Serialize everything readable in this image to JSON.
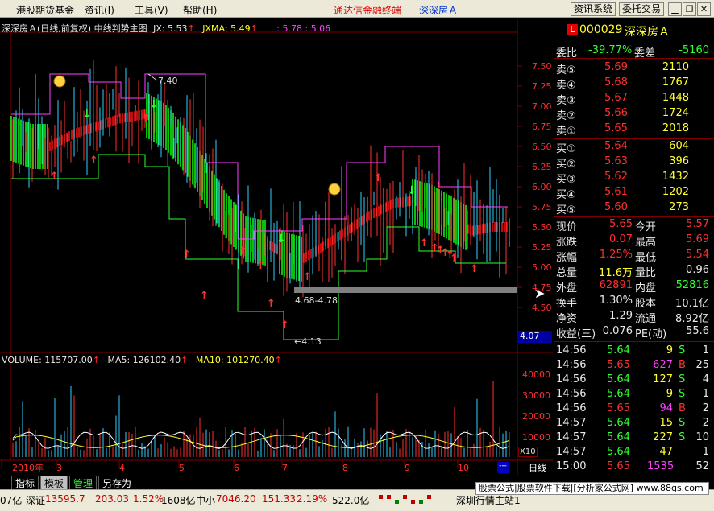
{
  "menu": {
    "item1": "港股期货基金",
    "item2": "资讯(I)",
    "item3": "工具(V)",
    "item4": "帮助(H)",
    "title": "通达信金融终端",
    "stock": "深深房Ａ",
    "btn_news": "资讯系统",
    "btn_order": "委托交易"
  },
  "chart": {
    "header": {
      "name": "深深房Ａ(日线,前复权) 中线判势主图",
      "jx": "JX: 5.53",
      "jxma": "JXMA: 5.49",
      "extra": ": 5.78 : 5.06"
    },
    "price_axis": [
      "7.50",
      "7.25",
      "7.00",
      "6.75",
      "6.50",
      "6.25",
      "6.00",
      "5.75",
      "5.50",
      "5.25",
      "5.00",
      "4.75",
      "4.50"
    ],
    "price_current": "4.07",
    "annotations": {
      "high": "7.40",
      "low": "4.13",
      "range": "4.68-4.78"
    },
    "volume_header": {
      "vol": "VOLUME: 115707.00",
      "ma5": "MA5: 126102.40",
      "ma10": "MA10: 101270.40"
    },
    "volume_axis": [
      "40000",
      "30000",
      "20000",
      "10000"
    ],
    "volume_unit": "X10",
    "dates": [
      "2010年",
      "3",
      "4",
      "5",
      "6",
      "7",
      "8",
      "9",
      "10"
    ],
    "period": "日线",
    "bottom_tabs": [
      "指标",
      "模板",
      "管理",
      "另存为"
    ]
  },
  "quote": {
    "code": "000029",
    "name": "深深房Ａ",
    "weibi_label": "委比",
    "weibi": "-39.77%",
    "weicha_label": "委差",
    "weicha": "-5160",
    "asks": [
      {
        "l": "卖⑤",
        "p": "5.69",
        "v": "2110"
      },
      {
        "l": "卖④",
        "p": "5.68",
        "v": "1767"
      },
      {
        "l": "卖③",
        "p": "5.67",
        "v": "1448"
      },
      {
        "l": "卖②",
        "p": "5.66",
        "v": "1724"
      },
      {
        "l": "卖①",
        "p": "5.65",
        "v": "2018"
      }
    ],
    "bids": [
      {
        "l": "买①",
        "p": "5.64",
        "v": "604"
      },
      {
        "l": "买②",
        "p": "5.63",
        "v": "396"
      },
      {
        "l": "买③",
        "p": "5.62",
        "v": "1432"
      },
      {
        "l": "买④",
        "p": "5.61",
        "v": "1202"
      },
      {
        "l": "买⑤",
        "p": "5.60",
        "v": "273"
      }
    ],
    "stats": [
      {
        "l1": "现价",
        "v1": "5.65",
        "l2": "今开",
        "v2": "5.57"
      },
      {
        "l1": "涨跌",
        "v1": "0.07",
        "l2": "最高",
        "v2": "5.69"
      },
      {
        "l1": "涨幅",
        "v1": "1.25%",
        "l2": "最低",
        "v2": "5.54"
      },
      {
        "l1": "总量",
        "v1": "11.6万",
        "l2": "量比",
        "v2": "0.96"
      },
      {
        "l1": "外盘",
        "v1": "62891",
        "l2": "内盘",
        "v2": "52816"
      },
      {
        "l1": "换手",
        "v1": "1.30%",
        "l2": "股本",
        "v2": "10.1亿"
      },
      {
        "l1": "净资",
        "v1": "1.29",
        "l2": "流通",
        "v2": "8.92亿"
      },
      {
        "l1": "收益(三)",
        "v1": "0.076",
        "l2": "PE(动)",
        "v2": "55.6"
      }
    ],
    "ticks": [
      {
        "t": "14:56",
        "p": "5.64",
        "v": "9",
        "s": "S",
        "n": "1"
      },
      {
        "t": "14:56",
        "p": "5.65",
        "v": "627",
        "s": "B",
        "n": "25"
      },
      {
        "t": "14:56",
        "p": "5.64",
        "v": "127",
        "s": "S",
        "n": "4"
      },
      {
        "t": "14:56",
        "p": "5.64",
        "v": "9",
        "s": "S",
        "n": "1"
      },
      {
        "t": "14:56",
        "p": "5.65",
        "v": "94",
        "s": "B",
        "n": "2"
      },
      {
        "t": "14:57",
        "p": "5.64",
        "v": "15",
        "s": "S",
        "n": "2"
      },
      {
        "t": "14:57",
        "p": "5.64",
        "v": "227",
        "s": "S",
        "n": "10"
      },
      {
        "t": "14:57",
        "p": "5.64",
        "v": "47",
        "s": "",
        "n": "1"
      },
      {
        "t": "15:00",
        "p": "5.65",
        "v": "1535",
        "s": "",
        "n": "52"
      }
    ]
  },
  "status": {
    "left": "07亿",
    "index1_name": "深证",
    "index1": "13595.7",
    "index1_chg": "203.03",
    "index1_pct": "1.52%",
    "index1_amt": "1608亿",
    "index2_name": "中小",
    "index2": "7046.20",
    "index2_chg": "151.33",
    "index2_pct": "2.19%",
    "index2_amt": "522.0亿",
    "right_text": "深圳行情主站1",
    "ad": "股票公式|股票软件下载|[分析家公式网] www.88gs.com"
  }
}
